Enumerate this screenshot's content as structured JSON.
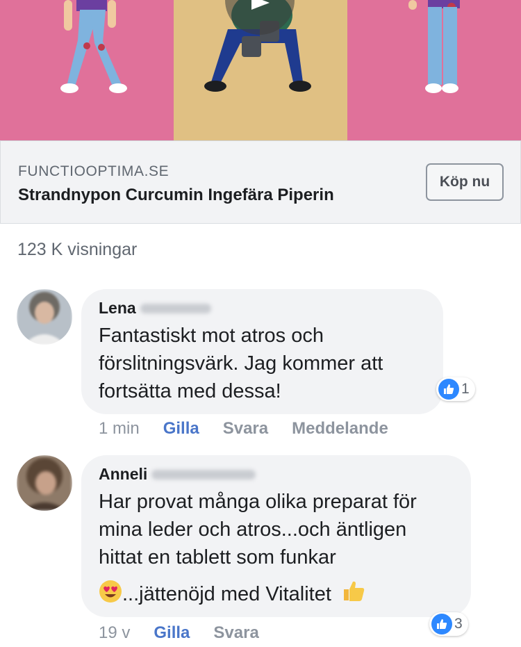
{
  "link_card": {
    "domain": "FUNCTIOOPTIMA.SE",
    "product": "Strandnypon Curcumin Ingefära Piperin",
    "buy_label": "Köp nu"
  },
  "views": "123 K visningar",
  "comments": [
    {
      "author": "Lena",
      "text": "Fantastiskt mot atros och förslitningsvärk.  Jag kommer att fortsätta med dessa!",
      "reaction_count": "1",
      "time": "1 min",
      "like": "Gilla",
      "reply": "Svara",
      "message": "Meddelande"
    },
    {
      "author": "Anneli",
      "text_lines": [
        "Har provat många olika preparat för",
        "mina leder och atros...och äntligen",
        "hittat en tablett som funkar"
      ],
      "last_line": "...jättenöjd med Vitalitet",
      "reaction_count": "3",
      "time": "19 v",
      "like": "Gilla",
      "reply": "Svara"
    }
  ],
  "colors": {
    "pink_panel": "#e0719a",
    "gold_panel": "#e0c083",
    "like_blue": "#2d88ff",
    "action_link": "#4a76c9"
  }
}
